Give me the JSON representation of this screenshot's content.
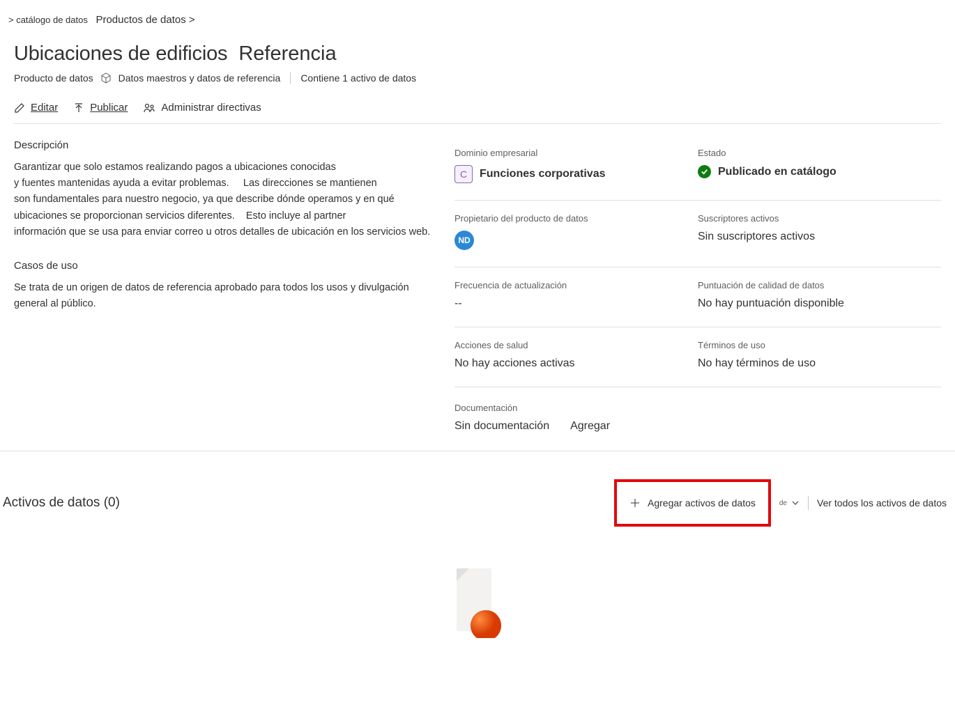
{
  "breadcrumb": {
    "item1": "> catálogo de datos",
    "item2": "Productos de datos >"
  },
  "header": {
    "title": "Ubicaciones de edificios",
    "badge": "Referencia",
    "product_label": "Producto de datos",
    "type_label": "Datos maestros y datos de referencia",
    "contains_label": "Contiene 1 activo de datos"
  },
  "actions": {
    "edit": "Editar",
    "publish": "Publicar",
    "manage_policies": "Administrar directivas"
  },
  "description": {
    "label": "Descripción",
    "line1": "Garantizar que solo estamos realizando pagos a ubicaciones conocidas",
    "line2a": "y fuentes mantenidas ayuda a evitar problemas.",
    "line2b": "Las direcciones se mantienen",
    "line3": "son fundamentales para nuestro negocio, ya que describe dónde operamos y en qué",
    "line4a": "ubicaciones se proporcionan servicios diferentes.",
    "line4b": "Esto incluye al partner",
    "line5": "información que se usa para enviar correo u otros detalles de ubicación en los servicios web."
  },
  "use_cases": {
    "label": "Casos de uso",
    "text": "Se trata de un origen de datos de referencia aprobado para todos los usos y divulgación general al público."
  },
  "meta": {
    "domain_label": "Dominio empresarial",
    "domain_badge": "C",
    "domain_value": "Funciones corporativas",
    "status_label": "Estado",
    "status_value": "Publicado en catálogo",
    "owner_label": "Propietario del producto de datos",
    "owner_initials": "ND",
    "subscribers_label": "Suscriptores activos",
    "subscribers_value": "Sin suscriptores activos",
    "update_freq_label": "Frecuencia de actualización",
    "update_freq_value": "--",
    "quality_label": "Puntuación de calidad de datos",
    "quality_value": "No hay puntuación disponible",
    "health_label": "Acciones de salud",
    "health_value": "No hay acciones activas",
    "terms_label": "Términos de uso",
    "terms_value": "No hay términos de uso",
    "doc_label": "Documentación",
    "doc_value": "Sin documentación",
    "doc_add": "Agregar"
  },
  "assets": {
    "title": "Activos de datos (0)",
    "add_button": "Agregar activos de datos",
    "dropdown_label": "de",
    "view_all": "Ver todos los activos de datos"
  }
}
